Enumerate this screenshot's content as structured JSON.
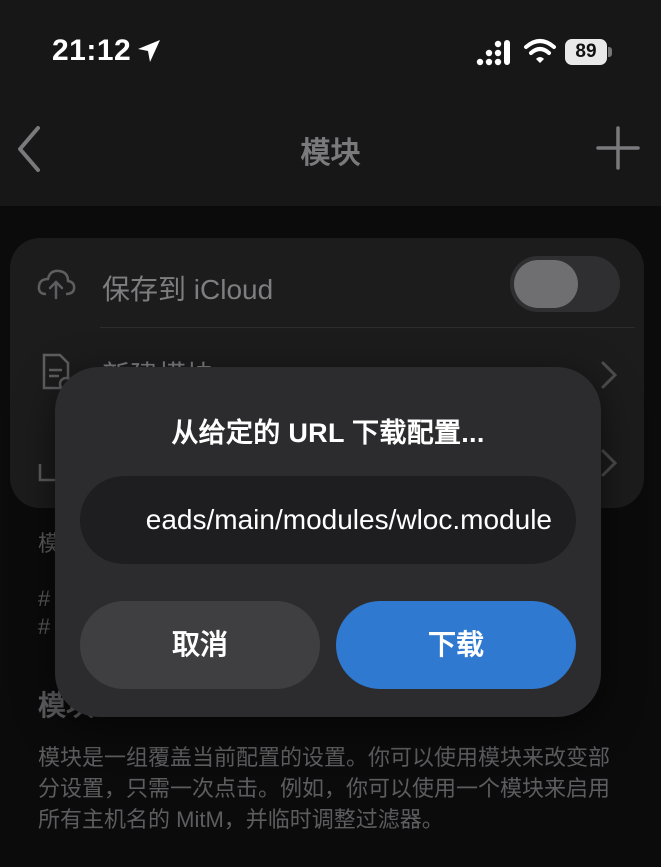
{
  "status_bar": {
    "time": "21:12",
    "battery": "89",
    "icons": [
      "location-arrow-icon",
      "cellular-signal-icon",
      "wifi-icon",
      "battery-icon"
    ]
  },
  "nav": {
    "title": "模块",
    "back_icon": "chevron-left-icon",
    "add_icon": "plus-icon"
  },
  "list": {
    "save_to_icloud": {
      "label": "保存到 iCloud",
      "icon": "cloud-upload-icon",
      "enabled": false
    },
    "new_module": {
      "label": "新建模块",
      "icon": "new-document-icon"
    },
    "third_row": {
      "icon": "download-icon"
    }
  },
  "background_text": {
    "section_note": "模",
    "hash1": "#",
    "hash2": "#",
    "heading": "模块",
    "description": "模块是一组覆盖当前配置的设置。你可以使用模块来改变部分设置，只需一次点击。例如，你可以使用一个模块来启用所有主机名的 MitM，并临时调整过滤器。"
  },
  "dialog": {
    "title": "从给定的 URL 下载配置...",
    "url_value": "eads/main/modules/wloc.module",
    "cancel_label": "取消",
    "confirm_label": "下载"
  },
  "colors": {
    "accent": "#2f79d1",
    "modal_bg": "#2c2c2e",
    "field_bg": "#1e1e20"
  }
}
